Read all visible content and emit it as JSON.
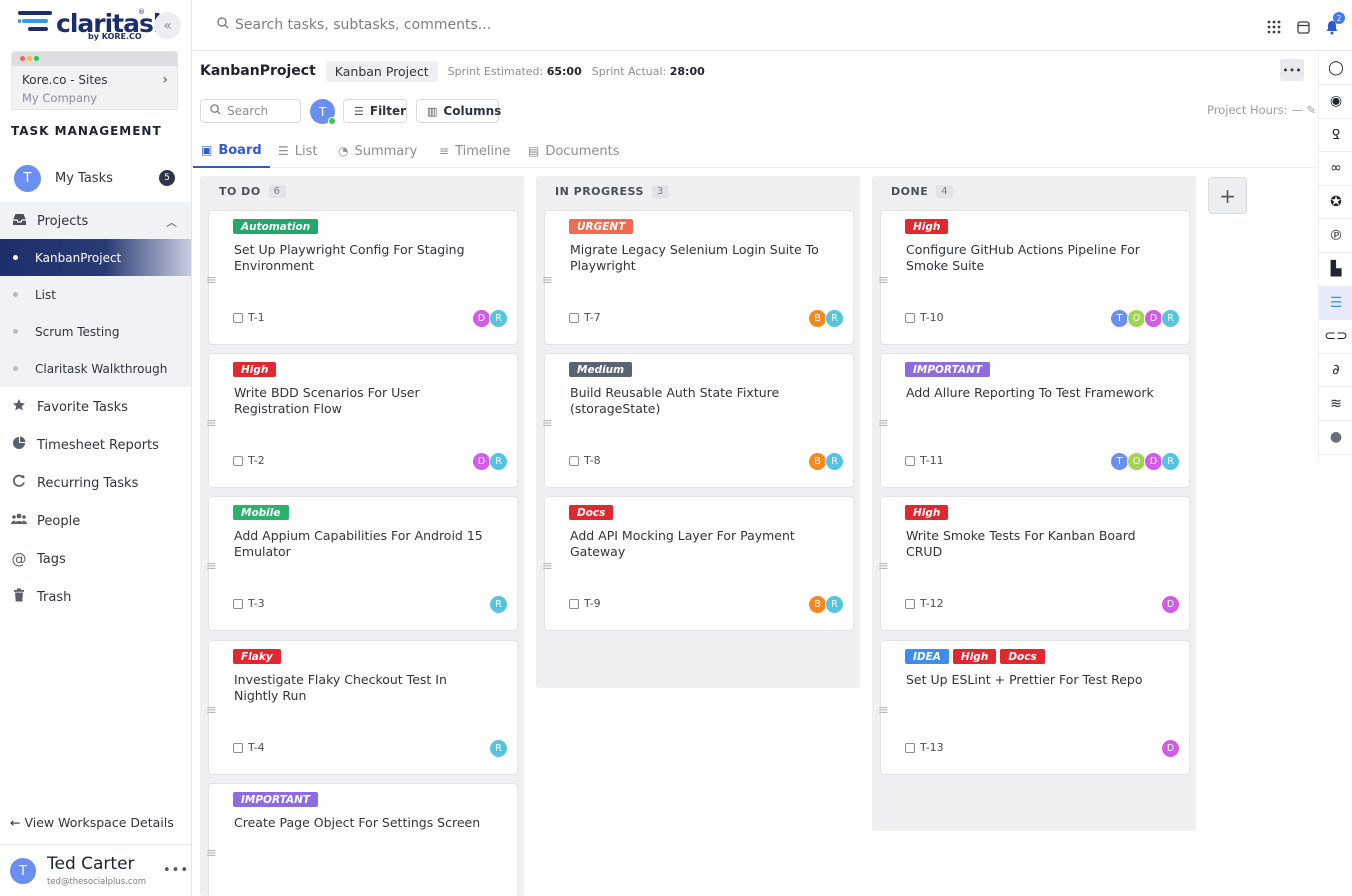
{
  "brand": {
    "name": "claritask",
    "by": "by KORE.CO",
    "reg": "®"
  },
  "workspace": {
    "name": "Kore.co - Sites",
    "company": "My Company"
  },
  "sidebar": {
    "section_title": "TASK MANAGEMENT",
    "my_tasks": {
      "label": "My Tasks",
      "avatar": "T",
      "count": "5"
    },
    "projects": {
      "label": "Projects"
    },
    "project_items": [
      {
        "label": "KanbanProject",
        "active": true
      },
      {
        "label": "List",
        "active": false
      },
      {
        "label": "Scrum Testing",
        "active": false
      },
      {
        "label": "Claritask Walkthrough",
        "active": false
      }
    ],
    "items": [
      {
        "label": "Favorite Tasks",
        "icon": "star-icon"
      },
      {
        "label": "Timesheet Reports",
        "icon": "pie-chart-icon"
      },
      {
        "label": "Recurring Tasks",
        "icon": "refresh-icon"
      },
      {
        "label": "People",
        "icon": "people-icon"
      },
      {
        "label": "Tags",
        "icon": "at-icon"
      },
      {
        "label": "Trash",
        "icon": "trash-icon"
      }
    ],
    "view_workspace": "← View Workspace Details",
    "user": {
      "name": "Ted Carter",
      "email": "ted@thesocialplus.com",
      "avatar": "T"
    }
  },
  "topbar": {
    "search_placeholder": "Search tasks, subtasks, comments...",
    "notification_count": "2"
  },
  "project": {
    "title": "KanbanProject",
    "chip": "Kanban Project",
    "sprint_estimated_label": "Sprint Estimated:",
    "sprint_estimated": "65:00",
    "sprint_actual_label": "Sprint Actual:",
    "sprint_actual": "28:00",
    "hours_label": "Project Hours: —"
  },
  "toolbar": {
    "search_placeholder": "Search",
    "avatar": "T",
    "filter": "Filter",
    "columns": "Columns"
  },
  "tabs": [
    {
      "label": "Board",
      "icon": "board-icon"
    },
    {
      "label": "List",
      "icon": "list-icon"
    },
    {
      "label": "Summary",
      "icon": "summary-icon"
    },
    {
      "label": "Timeline",
      "icon": "timeline-icon"
    },
    {
      "label": "Documents",
      "icon": "document-icon"
    }
  ],
  "colors": {
    "tag": {
      "Automation": "#22a86a",
      "High": "#e0282e",
      "Mobile": "#2bb36d",
      "Flaky": "#e0282e",
      "IMPORTANT": "#8f6be0",
      "URGENT": "#f26b50",
      "Medium": "#5a6375",
      "Docs": "#e0282e",
      "IDEA": "#3d8cf0"
    },
    "avatar": {
      "D": "#d35be9",
      "R": "#55c4e0",
      "B": "#f5891f",
      "T": "#6b8ff0",
      "O": "#9fd553"
    }
  },
  "columns": [
    {
      "name": "TO DO",
      "count": "6",
      "cards": [
        {
          "tags": [
            "Automation"
          ],
          "title": "Set Up Playwright Config For Staging Environment",
          "key": "T-1",
          "assignees": [
            "D",
            "R"
          ]
        },
        {
          "tags": [
            "High"
          ],
          "title": "Write BDD Scenarios For User Registration Flow",
          "key": "T-2",
          "assignees": [
            "D",
            "R"
          ]
        },
        {
          "tags": [
            "Mobile"
          ],
          "title": "Add Appium Capabilities For Android 15 Emulator",
          "key": "T-3",
          "assignees": [
            "R"
          ]
        },
        {
          "tags": [
            "Flaky"
          ],
          "title": "Investigate Flaky Checkout Test In Nightly Run",
          "key": "T-4",
          "assignees": [
            "R"
          ]
        },
        {
          "tags": [
            "IMPORTANT"
          ],
          "title": "Create Page Object For Settings Screen",
          "key": "",
          "assignees": []
        }
      ]
    },
    {
      "name": "IN PROGRESS",
      "count": "3",
      "cards": [
        {
          "tags": [
            "URGENT"
          ],
          "title": "Migrate Legacy Selenium Login Suite To Playwright",
          "key": "T-7",
          "assignees": [
            "B",
            "R"
          ]
        },
        {
          "tags": [
            "Medium"
          ],
          "title": "Build Reusable Auth State Fixture (storageState)",
          "key": "T-8",
          "assignees": [
            "B",
            "R"
          ]
        },
        {
          "tags": [
            "Docs"
          ],
          "title": "Add API Mocking Layer For Payment Gateway",
          "key": "T-9",
          "assignees": [
            "B",
            "R"
          ]
        }
      ]
    },
    {
      "name": "DONE",
      "count": "4",
      "cards": [
        {
          "tags": [
            "High"
          ],
          "title": "Configure GitHub Actions Pipeline For Smoke Suite",
          "key": "T-10",
          "assignees": [
            "T",
            "O",
            "D",
            "R"
          ]
        },
        {
          "tags": [
            "IMPORTANT"
          ],
          "title": "Add Allure Reporting To Test Framework",
          "key": "T-11",
          "assignees": [
            "T",
            "O",
            "D",
            "R"
          ]
        },
        {
          "tags": [
            "High"
          ],
          "title": "Write Smoke Tests For Kanban Board CRUD",
          "key": "T-12",
          "assignees": [
            "D"
          ]
        },
        {
          "tags": [
            "IDEA",
            "High",
            "Docs"
          ],
          "title": "Set Up ESLint + Prettier For Test Repo",
          "key": "T-13",
          "assignees": [
            "D"
          ]
        }
      ]
    }
  ],
  "app_rail": [
    "ring-icon",
    "target-icon",
    "script-icon",
    "chain-icon",
    "star-badge-icon",
    "pen-icon",
    "bars-icon",
    "claritask-icon",
    "link-icon",
    "swirl-icon",
    "stack-icon",
    "globe-icon"
  ]
}
